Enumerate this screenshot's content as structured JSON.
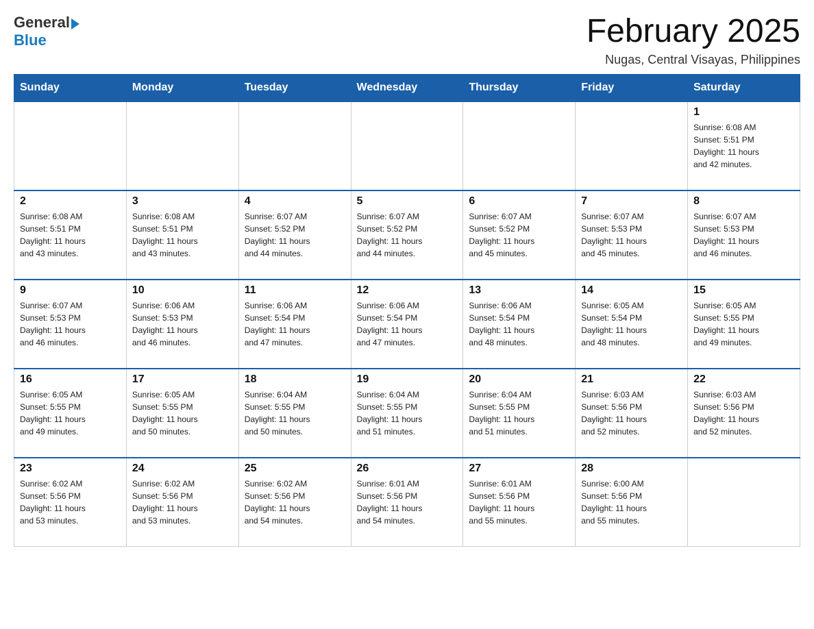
{
  "header": {
    "logo": {
      "general": "General",
      "arrow": "▶",
      "blue": "Blue"
    },
    "title": "February 2025",
    "location": "Nugas, Central Visayas, Philippines"
  },
  "days_of_week": [
    "Sunday",
    "Monday",
    "Tuesday",
    "Wednesday",
    "Thursday",
    "Friday",
    "Saturday"
  ],
  "weeks": [
    [
      {
        "day": "",
        "info": ""
      },
      {
        "day": "",
        "info": ""
      },
      {
        "day": "",
        "info": ""
      },
      {
        "day": "",
        "info": ""
      },
      {
        "day": "",
        "info": ""
      },
      {
        "day": "",
        "info": ""
      },
      {
        "day": "1",
        "info": "Sunrise: 6:08 AM\nSunset: 5:51 PM\nDaylight: 11 hours\nand 42 minutes."
      }
    ],
    [
      {
        "day": "2",
        "info": "Sunrise: 6:08 AM\nSunset: 5:51 PM\nDaylight: 11 hours\nand 43 minutes."
      },
      {
        "day": "3",
        "info": "Sunrise: 6:08 AM\nSunset: 5:51 PM\nDaylight: 11 hours\nand 43 minutes."
      },
      {
        "day": "4",
        "info": "Sunrise: 6:07 AM\nSunset: 5:52 PM\nDaylight: 11 hours\nand 44 minutes."
      },
      {
        "day": "5",
        "info": "Sunrise: 6:07 AM\nSunset: 5:52 PM\nDaylight: 11 hours\nand 44 minutes."
      },
      {
        "day": "6",
        "info": "Sunrise: 6:07 AM\nSunset: 5:52 PM\nDaylight: 11 hours\nand 45 minutes."
      },
      {
        "day": "7",
        "info": "Sunrise: 6:07 AM\nSunset: 5:53 PM\nDaylight: 11 hours\nand 45 minutes."
      },
      {
        "day": "8",
        "info": "Sunrise: 6:07 AM\nSunset: 5:53 PM\nDaylight: 11 hours\nand 46 minutes."
      }
    ],
    [
      {
        "day": "9",
        "info": "Sunrise: 6:07 AM\nSunset: 5:53 PM\nDaylight: 11 hours\nand 46 minutes."
      },
      {
        "day": "10",
        "info": "Sunrise: 6:06 AM\nSunset: 5:53 PM\nDaylight: 11 hours\nand 46 minutes."
      },
      {
        "day": "11",
        "info": "Sunrise: 6:06 AM\nSunset: 5:54 PM\nDaylight: 11 hours\nand 47 minutes."
      },
      {
        "day": "12",
        "info": "Sunrise: 6:06 AM\nSunset: 5:54 PM\nDaylight: 11 hours\nand 47 minutes."
      },
      {
        "day": "13",
        "info": "Sunrise: 6:06 AM\nSunset: 5:54 PM\nDaylight: 11 hours\nand 48 minutes."
      },
      {
        "day": "14",
        "info": "Sunrise: 6:05 AM\nSunset: 5:54 PM\nDaylight: 11 hours\nand 48 minutes."
      },
      {
        "day": "15",
        "info": "Sunrise: 6:05 AM\nSunset: 5:55 PM\nDaylight: 11 hours\nand 49 minutes."
      }
    ],
    [
      {
        "day": "16",
        "info": "Sunrise: 6:05 AM\nSunset: 5:55 PM\nDaylight: 11 hours\nand 49 minutes."
      },
      {
        "day": "17",
        "info": "Sunrise: 6:05 AM\nSunset: 5:55 PM\nDaylight: 11 hours\nand 50 minutes."
      },
      {
        "day": "18",
        "info": "Sunrise: 6:04 AM\nSunset: 5:55 PM\nDaylight: 11 hours\nand 50 minutes."
      },
      {
        "day": "19",
        "info": "Sunrise: 6:04 AM\nSunset: 5:55 PM\nDaylight: 11 hours\nand 51 minutes."
      },
      {
        "day": "20",
        "info": "Sunrise: 6:04 AM\nSunset: 5:55 PM\nDaylight: 11 hours\nand 51 minutes."
      },
      {
        "day": "21",
        "info": "Sunrise: 6:03 AM\nSunset: 5:56 PM\nDaylight: 11 hours\nand 52 minutes."
      },
      {
        "day": "22",
        "info": "Sunrise: 6:03 AM\nSunset: 5:56 PM\nDaylight: 11 hours\nand 52 minutes."
      }
    ],
    [
      {
        "day": "23",
        "info": "Sunrise: 6:02 AM\nSunset: 5:56 PM\nDaylight: 11 hours\nand 53 minutes."
      },
      {
        "day": "24",
        "info": "Sunrise: 6:02 AM\nSunset: 5:56 PM\nDaylight: 11 hours\nand 53 minutes."
      },
      {
        "day": "25",
        "info": "Sunrise: 6:02 AM\nSunset: 5:56 PM\nDaylight: 11 hours\nand 54 minutes."
      },
      {
        "day": "26",
        "info": "Sunrise: 6:01 AM\nSunset: 5:56 PM\nDaylight: 11 hours\nand 54 minutes."
      },
      {
        "day": "27",
        "info": "Sunrise: 6:01 AM\nSunset: 5:56 PM\nDaylight: 11 hours\nand 55 minutes."
      },
      {
        "day": "28",
        "info": "Sunrise: 6:00 AM\nSunset: 5:56 PM\nDaylight: 11 hours\nand 55 minutes."
      },
      {
        "day": "",
        "info": ""
      }
    ]
  ]
}
